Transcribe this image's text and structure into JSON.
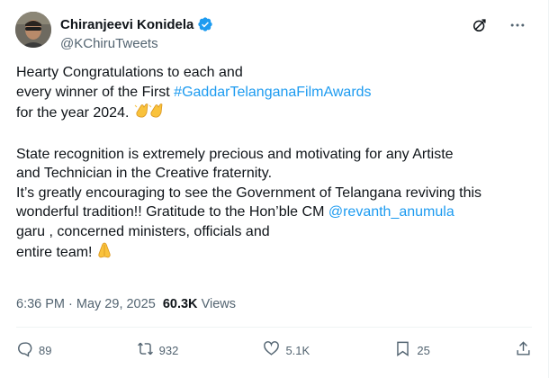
{
  "author": {
    "name": "Chiranjeevi Konidela",
    "handle": "@KChiruTweets"
  },
  "tweet": {
    "line1": "Hearty Congratulations to each and",
    "line2_prefix": "every winner of the First ",
    "hashtag": "#GaddarTelanganaFilmAwards",
    "line3": "for the year 2024.",
    "para2_line1": "State recognition is extremely precious and motivating for any Artiste",
    "para2_line2": "and Technician in the Creative fraternity.",
    "para2_line3": "It’s greatly encouraging to see the Government of Telangana reviving this",
    "para2_line4_prefix": "wonderful tradition!!  Gratitude to the Hon’ble CM ",
    "mention": "@revanth_anumula",
    "para2_line5": "garu , concerned ministers, officials and",
    "para2_line6": "entire team!"
  },
  "meta": {
    "time": "6:36 PM",
    "separator": " · ",
    "date": "May 29, 2025",
    "views_count": "60.3K",
    "views_label": "Views"
  },
  "actions": {
    "replies": "89",
    "reposts": "932",
    "likes": "5.1K",
    "bookmarks": "25"
  },
  "icons": [
    "verified-badge-icon",
    "grok-icon",
    "more-icon",
    "clapping-hands-emoji",
    "folded-hands-emoji",
    "reply-icon",
    "repost-icon",
    "like-icon",
    "bookmark-icon",
    "share-icon"
  ],
  "colors": {
    "link": "#1d9bf0",
    "secondary_text": "#536471",
    "verified": "#1d9bf0"
  }
}
